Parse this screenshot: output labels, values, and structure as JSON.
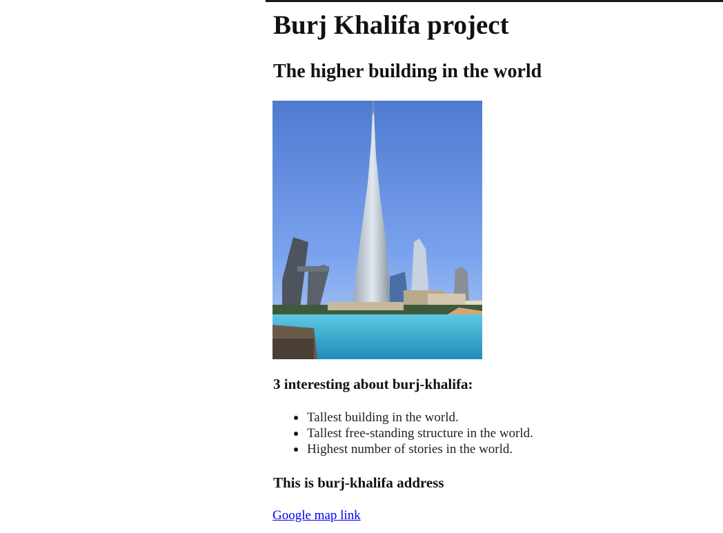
{
  "page": {
    "title": "Burj Khalifa project",
    "subtitle": "The higher building in the world"
  },
  "image": {
    "icon": "burj-khalifa-photo",
    "colors": {
      "sky_top": "#4f7bd0",
      "sky_bottom": "#a9c6f5",
      "water": "#3fb2d6"
    }
  },
  "facts": {
    "heading": "3 interesting about burj-khalifa:",
    "items": [
      "Tallest building in the world.",
      "Tallest free-standing structure in the world.",
      "Highest number of stories in the world."
    ]
  },
  "address": {
    "heading": "This is burj-khalifa address",
    "link_label": "Google map link"
  }
}
